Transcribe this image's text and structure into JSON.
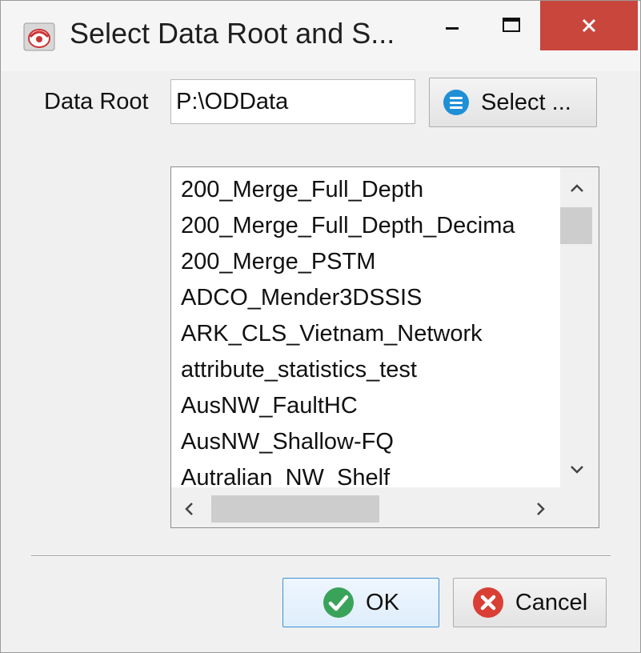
{
  "window": {
    "title": "Select Data Root and S...",
    "icon": "app-icon",
    "controls": {
      "minimize": "minimize-icon",
      "maximize": "maximize-icon",
      "close": "close-icon"
    }
  },
  "data_root": {
    "label": "Data Root",
    "value": "P:\\ODData",
    "select_button_label": "Select ...",
    "select_icon": "list-icon"
  },
  "survey_list": {
    "items": [
      "200_Merge_Full_Depth",
      "200_Merge_Full_Depth_Decima",
      "200_Merge_PSTM",
      "ADCO_Mender3DSSIS",
      "ARK_CLS_Vietnam_Network",
      "attribute_statistics_test",
      "AusNW_FaultHC",
      "AusNW_Shallow-FQ",
      "Autralian_NW_Shelf"
    ],
    "scroll_up": "‸",
    "scroll_down": "⌄",
    "scroll_left": "<",
    "scroll_right": ">"
  },
  "buttons": {
    "ok_label": "OK",
    "cancel_label": "Cancel",
    "ok_icon": "check-icon",
    "cancel_icon": "cancel-icon"
  },
  "colors": {
    "close_red": "#c9463d",
    "ok_green": "#3aa35a",
    "cancel_red": "#d93f35",
    "select_blue": "#1f8fd6"
  }
}
